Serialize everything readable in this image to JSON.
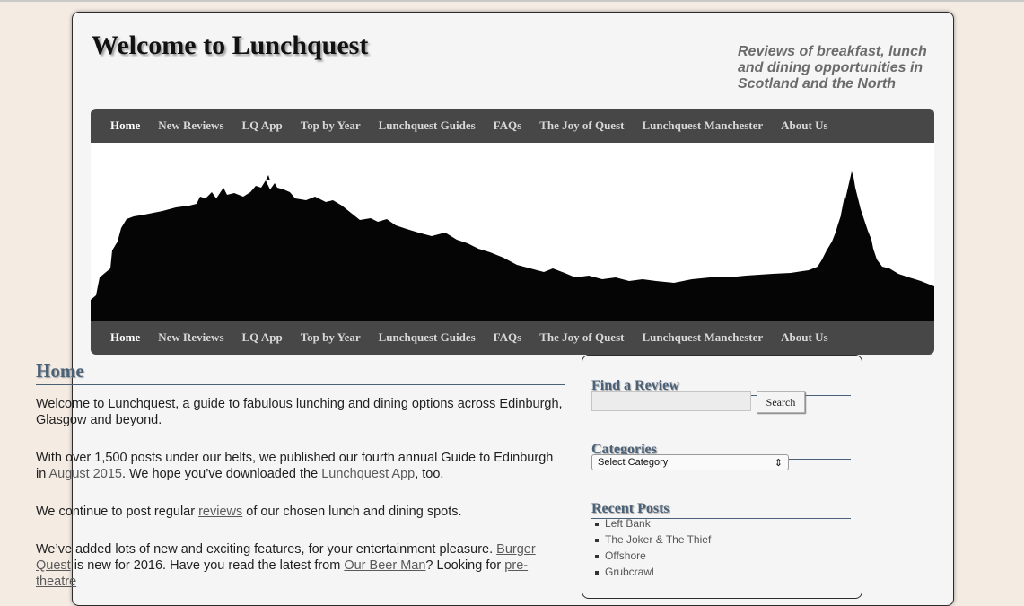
{
  "site": {
    "title": "Welcome to Lunchquest",
    "tagline": "Reviews of breakfast, lunch and dining opportunities in Scotland and the North"
  },
  "nav": {
    "items": [
      {
        "label": "Home"
      },
      {
        "label": "New Reviews"
      },
      {
        "label": "LQ App"
      },
      {
        "label": "Top by Year"
      },
      {
        "label": "Lunchquest Guides"
      },
      {
        "label": "FAQs"
      },
      {
        "label": "The Joy of Quest"
      },
      {
        "label": "Lunchquest Manchester"
      },
      {
        "label": "About Us"
      }
    ]
  },
  "main": {
    "heading": "Home",
    "p1": "Welcome to Lunchquest, a guide to fabulous lunching and dining options across Edinburgh, Glasgow and beyond.",
    "p2": {
      "text1": "With over 1,500 posts under our belts, we published our fourth annual Guide to Edinburgh in ",
      "link1": "August 2015",
      "text2": ". We hope you’ve downloaded the ",
      "link2": "Lunchquest App",
      "text3": ", too."
    },
    "p3": {
      "text1": "We continue to post regular ",
      "link1": "reviews",
      "text2": " of our chosen lunch and dining spots."
    },
    "p4": {
      "text1": "We’ve added lots of new and exciting features, for your entertainment pleasure. ",
      "link1": "Burger Quest",
      "text2": " is new for 2016. Have you read the latest from ",
      "link2": "Our Beer Man",
      "text3": "? Looking for ",
      "link3": "pre-theatre"
    }
  },
  "sidebar": {
    "find_title": "Find a Review",
    "search_button": "Search",
    "categories_title": "Categories",
    "category_selected": "Select Category",
    "recent_title": "Recent Posts",
    "recent_posts": [
      "Left Bank",
      "The Joker & The Thief",
      "Offshore",
      "Grubcrawl"
    ]
  }
}
